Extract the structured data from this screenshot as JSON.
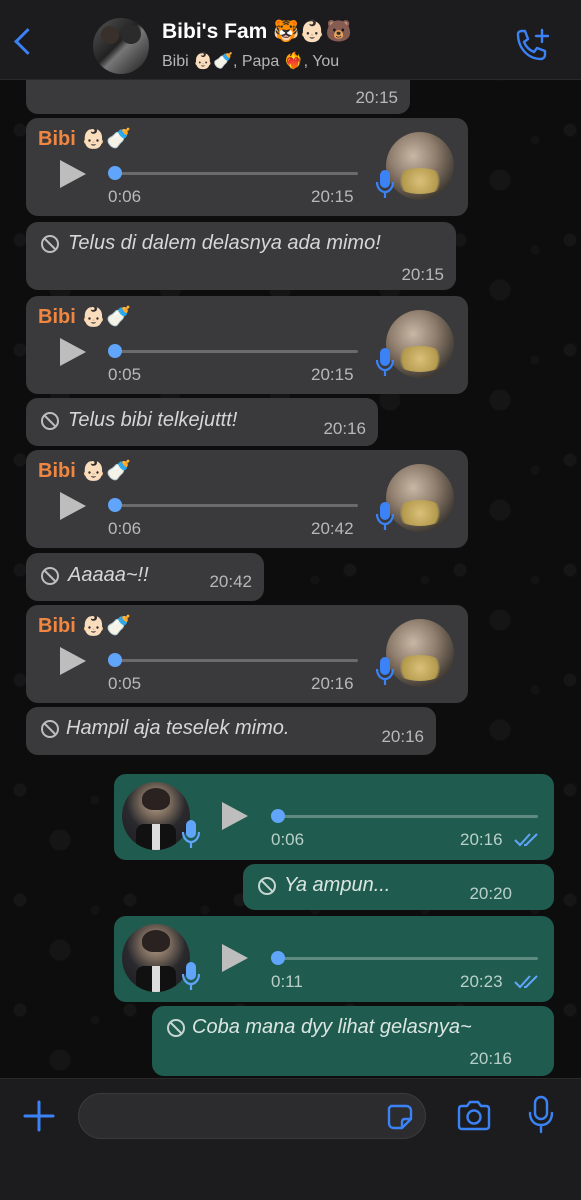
{
  "header": {
    "title": "Bibi's Fam 🐯👶🏻🐻",
    "subtitle": "Bibi 👶🏻🍼, Papa ❤️‍🔥, You",
    "back_icon": "chevron-left-icon",
    "call_icon": "phone-add-icon"
  },
  "messages": [
    {
      "type": "partial",
      "time": "20:15"
    },
    {
      "type": "voice",
      "sender": "Bibi 👶🏻🍼",
      "duration": "0:06",
      "time": "20:15"
    },
    {
      "type": "deleted",
      "text": "Telus di dalem delasnya ada mimo!",
      "time": "20:15"
    },
    {
      "type": "voice",
      "sender": "Bibi 👶🏻🍼",
      "duration": "0:05",
      "time": "20:15"
    },
    {
      "type": "deleted",
      "text": "Telus bibi telkejuttt!",
      "time": "20:16"
    },
    {
      "type": "voice",
      "sender": "Bibi 👶🏻🍼",
      "duration": "0:06",
      "time": "20:42"
    },
    {
      "type": "deleted",
      "text": "Aaaaa~!!",
      "time": "20:42"
    },
    {
      "type": "voice",
      "sender": "Bibi 👶🏻🍼",
      "duration": "0:05",
      "time": "20:16"
    },
    {
      "type": "deleted",
      "text": "Hampil aja teselek mimo.",
      "time": "20:16"
    },
    {
      "type": "voice_out",
      "duration": "0:06",
      "time": "20:16",
      "read": true
    },
    {
      "type": "deleted_out",
      "text": "Ya ampun...",
      "time": "20:20"
    },
    {
      "type": "voice_out",
      "duration": "0:11",
      "time": "20:23",
      "read": true
    },
    {
      "type": "deleted_out",
      "text": "Coba mana dyy lihat gelasnya~",
      "time": "20:16"
    }
  ],
  "input": {
    "placeholder": "",
    "plus_icon": "plus-icon",
    "sticker_icon": "sticker-icon",
    "camera_icon": "camera-icon",
    "mic_icon": "microphone-icon"
  },
  "colors": {
    "accent": "#3b82f6",
    "sender": "#f0863f",
    "incoming_bubble": "#3a3a3c",
    "outgoing_bubble": "#1f5c4f",
    "progress_dot": "#60a5fa"
  }
}
